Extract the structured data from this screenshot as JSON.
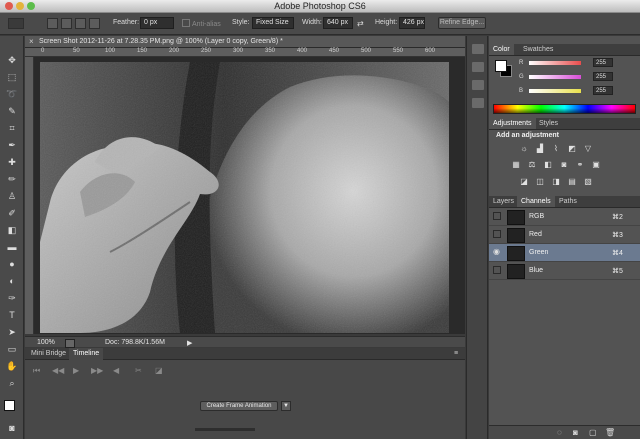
{
  "window": {
    "title": "Adobe Photoshop CS6"
  },
  "options": {
    "feather_label": "Feather:",
    "feather_value": "0 px",
    "antialias_label": "Anti-alias",
    "style_label": "Style:",
    "style_value": "Fixed Size",
    "width_label": "Width:",
    "width_value": "640 px",
    "height_label": "Height:",
    "height_value": "426 px",
    "refine_edge": "Refine Edge..."
  },
  "document": {
    "tab_title": "Screen Shot 2012-11-26 at 7.28.35 PM.png @ 100% (Layer 0 copy, Green/8) *",
    "ruler_ticks": [
      "0",
      "50",
      "100",
      "150",
      "200",
      "250",
      "300",
      "350",
      "400",
      "450",
      "500",
      "550",
      "600"
    ],
    "zoom": "100%",
    "doc_size": "Doc: 798.8K/1.56M"
  },
  "timeline": {
    "tabs": [
      "Mini Bridge",
      "Timeline"
    ],
    "create_button": "Create Frame Animation"
  },
  "color_panel": {
    "tabs": [
      "Color",
      "Swatches"
    ],
    "channels": [
      {
        "label": "R",
        "value": "255",
        "color": "#e84c4c"
      },
      {
        "label": "G",
        "value": "255",
        "color": "#d84ed8"
      },
      {
        "label": "B",
        "value": "255",
        "color": "#e8e04c"
      }
    ]
  },
  "adjustments_panel": {
    "tabs": [
      "Adjustments",
      "Styles"
    ],
    "heading": "Add an adjustment"
  },
  "channels_panel": {
    "tabs": [
      "Layers",
      "Channels",
      "Paths"
    ],
    "rows": [
      {
        "name": "RGB",
        "shortcut": "⌘2",
        "selected": false
      },
      {
        "name": "Red",
        "shortcut": "⌘3",
        "selected": false
      },
      {
        "name": "Green",
        "shortcut": "⌘4",
        "selected": true
      },
      {
        "name": "Blue",
        "shortcut": "⌘5",
        "selected": false
      }
    ]
  }
}
